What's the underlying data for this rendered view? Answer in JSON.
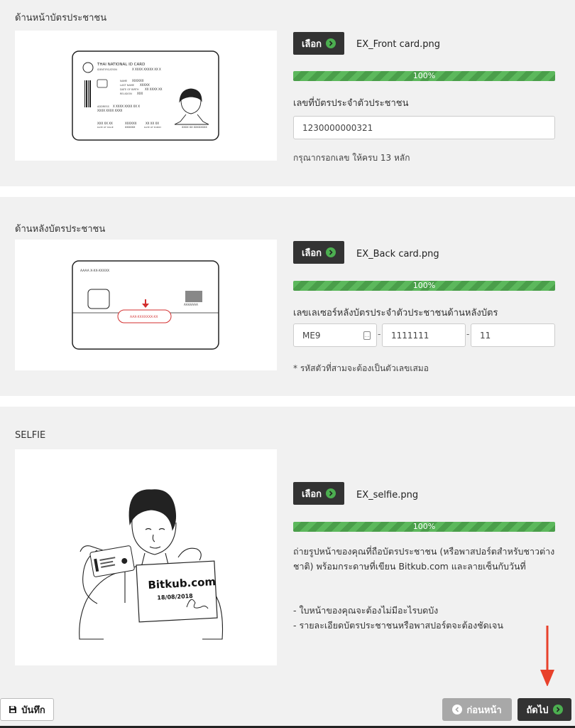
{
  "front": {
    "title": "ด้านหน้าบัตรประชาชน",
    "pick_label": "เลือก",
    "filename": "EX_Front card.png",
    "progress": 100,
    "progress_label": "100%",
    "field_label": "เลขที่บัตรประจำตัวประชาชน",
    "field_value": "1230000000321",
    "hint": "กรุณากรอกเลข ให้ครบ 13 หลัก",
    "card": {
      "heading": "THAI NATIONAL ID CARD",
      "identification": "IDENTIFICATION",
      "id_value": "X XXXX XXXXX XX X",
      "name": "NAME",
      "name_value": "XXXXXX",
      "last_name": "LAST NAME",
      "last_name_value": "XXXXX",
      "dob": "DATE OF BIRTH",
      "dob_value": "XX XXXX XX",
      "religion": "RELIGION",
      "religion_value": "XXX",
      "address": "ADDRESS",
      "address_value": "X XXXX XXXX XX X",
      "address_line2": "XXXX XXXX XXXX",
      "issue_value": "XXX XX XX",
      "issue_label": "DATE OF ISSUE",
      "mid_value": "XXXXXX",
      "mid_value2": "XXXXXX",
      "expiry_value": "XX XX XX",
      "expiry_label": "DATE OF EXPIRY",
      "serial": "XXXX XX XXXXXXXX"
    }
  },
  "back": {
    "title": "ด้านหลังบัตรประชาชน",
    "pick_label": "เลือก",
    "filename": "EX_Back card.png",
    "progress": 100,
    "progress_label": "100%",
    "field_label": "เลขเลเซอร์หลังบัตรประจำตัวประชาชนด้านหลังบัตร",
    "laser_part1": "ME9",
    "laser_part2": "1111111",
    "laser_part3": "11",
    "dash": "-",
    "hint": "* รหัสตัวที่สามจะต้องเป็นตัวเลขเสมอ",
    "card": {
      "top_code": "AAAA X-XX-XXXXX",
      "laser_code": "AAX-XXXXXXX-XX",
      "barcode_text": "AAAAAAA"
    }
  },
  "selfie": {
    "title": "SELFIE",
    "pick_label": "เลือก",
    "filename": "EX_selfie.png",
    "progress": 100,
    "progress_label": "100%",
    "description": "ถ่ายรูปหน้าของคุณที่ถือบัตรประชาชน (หรือพาสปอร์ตสำหรับชาวต่างชาติ) พร้อมกระดาษที่เขียน Bitkub.com และลายเซ็นกับวันที่",
    "bullets": [
      "- ใบหน้าของคุณจะต้องไม่มีอะไรบดบัง",
      "- รายละเอียดบัตรประชาชนหรือพาสปอร์ตจะต้องชัดเจน"
    ],
    "paper_brand": "Bitkub.com",
    "paper_date": "18/08/2018"
  },
  "footer": {
    "save_label": "บันทึก",
    "prev_label": "ก่อนหน้า",
    "next_label": "ถัดไป"
  },
  "colors": {
    "progress": "#5cb85c",
    "dark_button": "#333333",
    "accent_green": "#4caf50",
    "annotation_arrow": "#e8412b",
    "section_bg": "#f1f1f1"
  }
}
